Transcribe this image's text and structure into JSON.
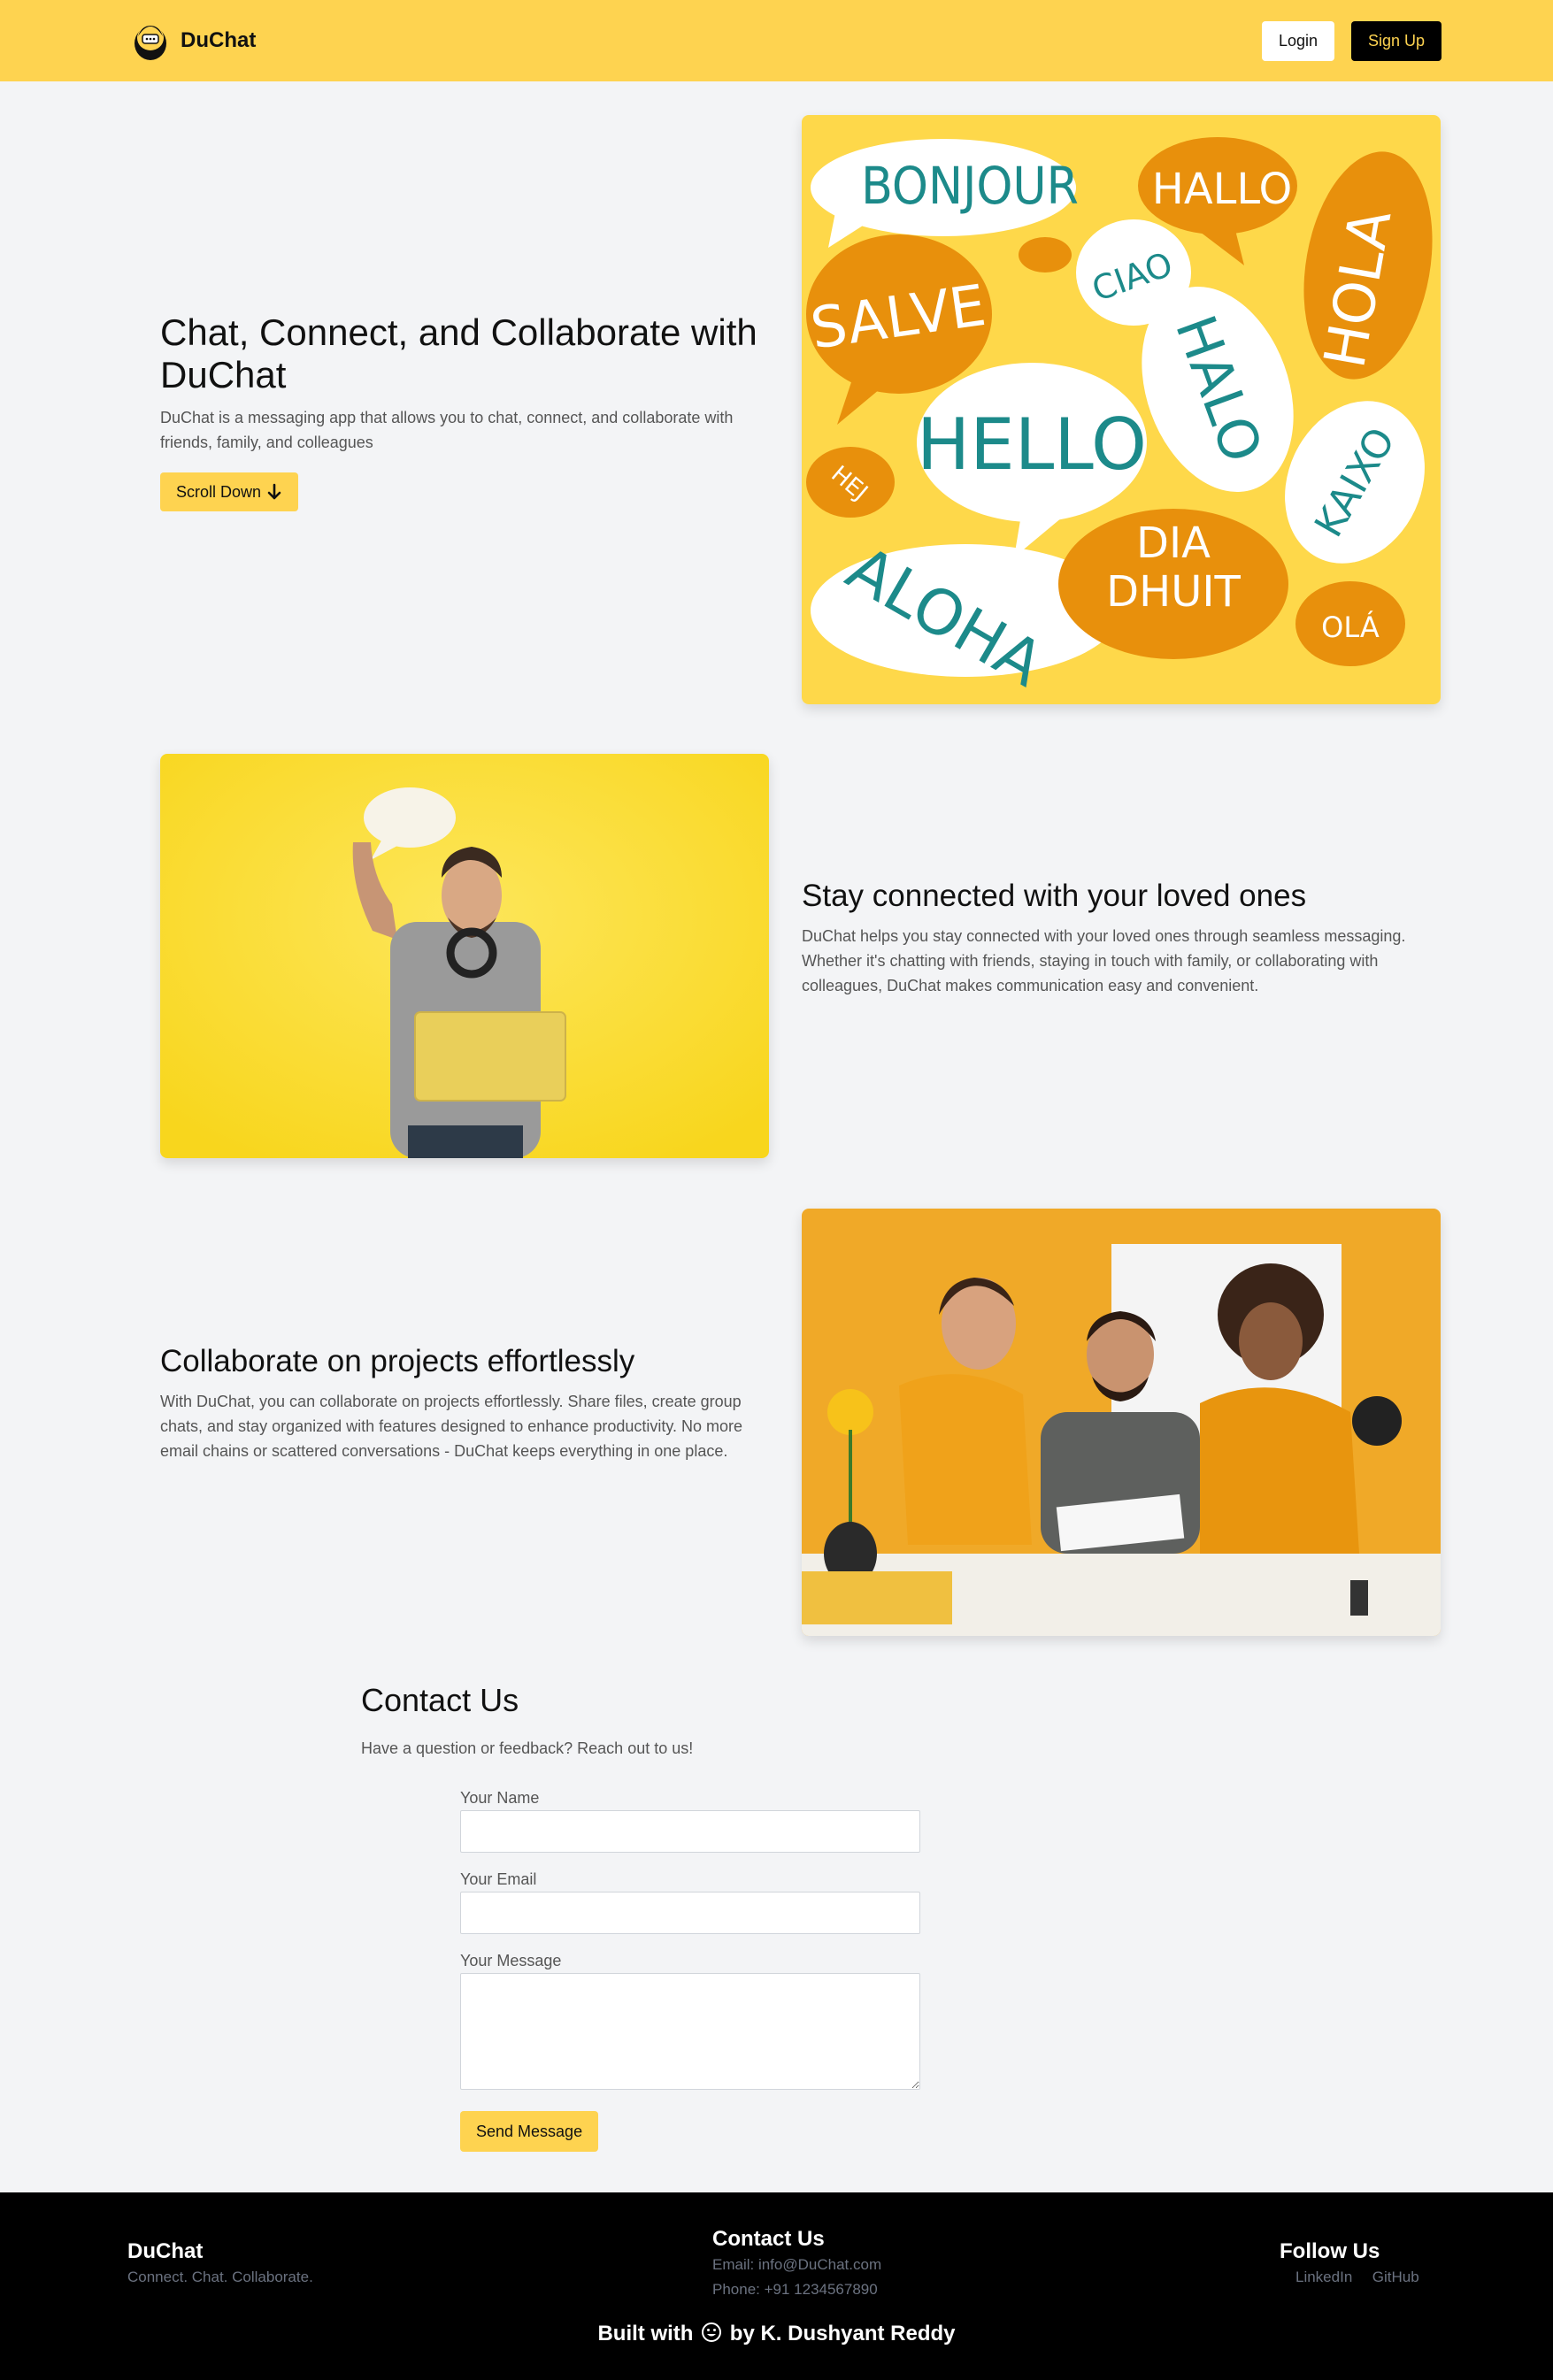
{
  "brand": {
    "name": "DuChat"
  },
  "nav": {
    "login_label": "Login",
    "signup_label": "Sign Up"
  },
  "hero": {
    "title": "Chat, Connect, and Collaborate with DuChat",
    "description": "DuChat is a messaging app that allows you to chat, connect, and collaborate with friends, family, and colleagues",
    "scroll_label": "Scroll Down",
    "bubbles": [
      "BONJOUR",
      "HALLO",
      "SALVE",
      "CIAO",
      "HOLA",
      "HALO",
      "HELLO",
      "HEJ",
      "KAIXO",
      "ALOHA",
      "DIA",
      "DHUIT",
      "OLÁ"
    ]
  },
  "section_connect": {
    "title": "Stay connected with your loved ones",
    "description": "DuChat helps you stay connected with your loved ones through seamless messaging. Whether it's chatting with friends, staying in touch with family, or collaborating with colleagues, DuChat makes communication easy and convenient."
  },
  "section_collab": {
    "title": "Collaborate on projects effortlessly",
    "description": "With DuChat, you can collaborate on projects effortlessly. Share files, create group chats, and stay organized with features designed to enhance productivity. No more email chains or scattered conversations - DuChat keeps everything in one place."
  },
  "contact": {
    "title": "Contact Us",
    "subtitle": "Have a question or feedback? Reach out to us!",
    "name_label": "Your Name",
    "email_label": "Your Email",
    "message_label": "Your Message",
    "send_label": "Send Message"
  },
  "footer": {
    "brand": "DuChat",
    "tagline": "Connect. Chat. Collaborate.",
    "contact_title": "Contact Us",
    "email": "Email: info@DuChat.com",
    "phone": "Phone: +91 1234567890",
    "follow_title": "Follow Us",
    "linkedin": "LinkedIn",
    "github": "GitHub",
    "built_prefix": "Built with",
    "built_suffix": "by K. Dushyant Reddy"
  },
  "colors": {
    "accent": "#fed350",
    "dark": "#000000",
    "page_bg": "#f3f4f6",
    "teal": "#1c8a8a",
    "orange": "#e8900c"
  },
  "icons": {
    "logo": "chat-face-logo-icon",
    "scroll": "arrow-down-icon",
    "heart": "smile-face-icon"
  }
}
